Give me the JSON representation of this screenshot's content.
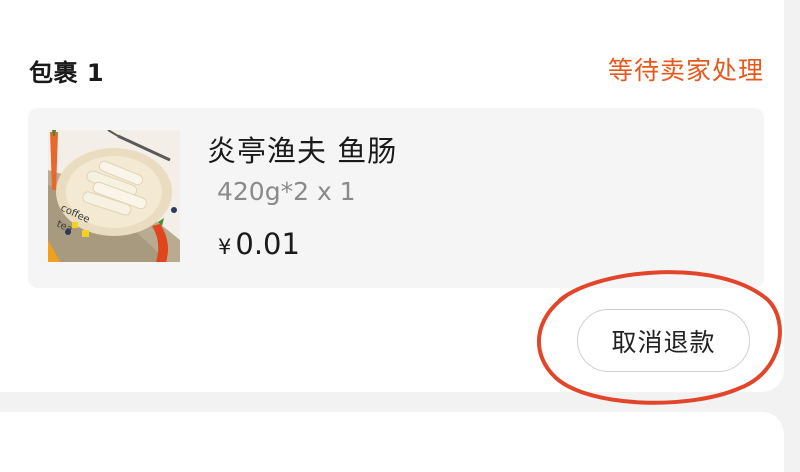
{
  "package": {
    "title": "包裹 1",
    "status": "等待卖家处理"
  },
  "item": {
    "name": "炎亭渔夫 鱼肠",
    "spec": "420g*2 x 1",
    "currency_symbol": "¥",
    "price": "0.01",
    "image_icon": "sausage-product-photo"
  },
  "actions": {
    "cancel_refund_label": "取消退款"
  },
  "colors": {
    "status": "#e8581c",
    "annotation_circle": "#e2452a"
  }
}
